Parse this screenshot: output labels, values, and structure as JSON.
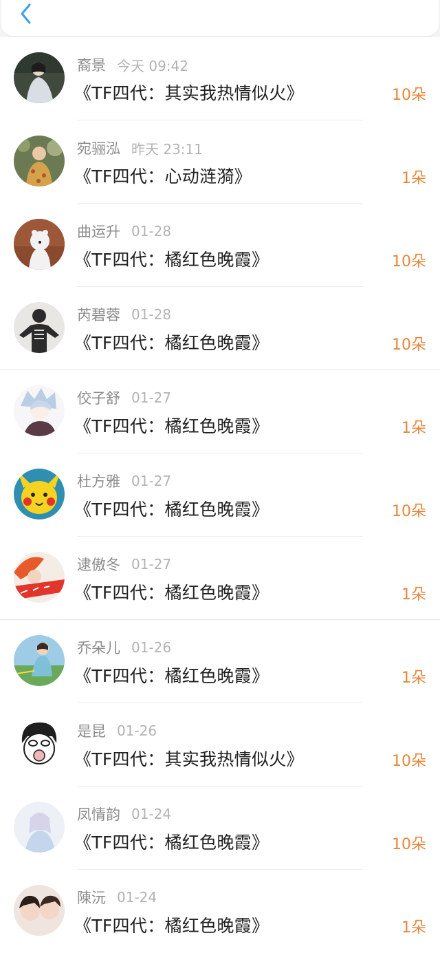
{
  "header": {
    "back_icon": "chevron-left-icon",
    "accent": "#3a9cf0"
  },
  "colors": {
    "count": "#e8853a",
    "name": "#8c8c8c",
    "time": "#b3b3b3",
    "title": "#222222"
  },
  "items": [
    {
      "name": "裔景",
      "time": "今天 09:42",
      "title": "《TF四代：其实我热情似火》",
      "count": "10朵"
    },
    {
      "name": "宛骊泓",
      "time": "昨天 23:11",
      "title": "《TF四代：心动涟漪》",
      "count": "1朵"
    },
    {
      "name": "曲运升",
      "time": "01-28",
      "title": "《TF四代：橘红色晚霞》",
      "count": "10朵"
    },
    {
      "name": "芮碧蓉",
      "time": "01-28",
      "title": "《TF四代：橘红色晚霞》",
      "count": "10朵"
    },
    {
      "name": "佼子舒",
      "time": "01-27",
      "title": "《TF四代：橘红色晚霞》",
      "count": "1朵"
    },
    {
      "name": "杜方雅",
      "time": "01-27",
      "title": "《TF四代：橘红色晚霞》",
      "count": "10朵"
    },
    {
      "name": "逮傲冬",
      "time": "01-27",
      "title": "《TF四代：橘红色晚霞》",
      "count": "1朵"
    },
    {
      "name": "乔朵儿",
      "time": "01-26",
      "title": "《TF四代：橘红色晚霞》",
      "count": "1朵"
    },
    {
      "name": "是昆",
      "time": "01-26",
      "title": "《TF四代：其实我热情似火》",
      "count": "10朵"
    },
    {
      "name": "凤情韵",
      "time": "01-24",
      "title": "《TF四代：橘红色晚霞》",
      "count": "10朵"
    },
    {
      "name": "陳沅",
      "time": "01-24",
      "title": "《TF四代：橘红色晚霞》",
      "count": "1朵"
    }
  ]
}
